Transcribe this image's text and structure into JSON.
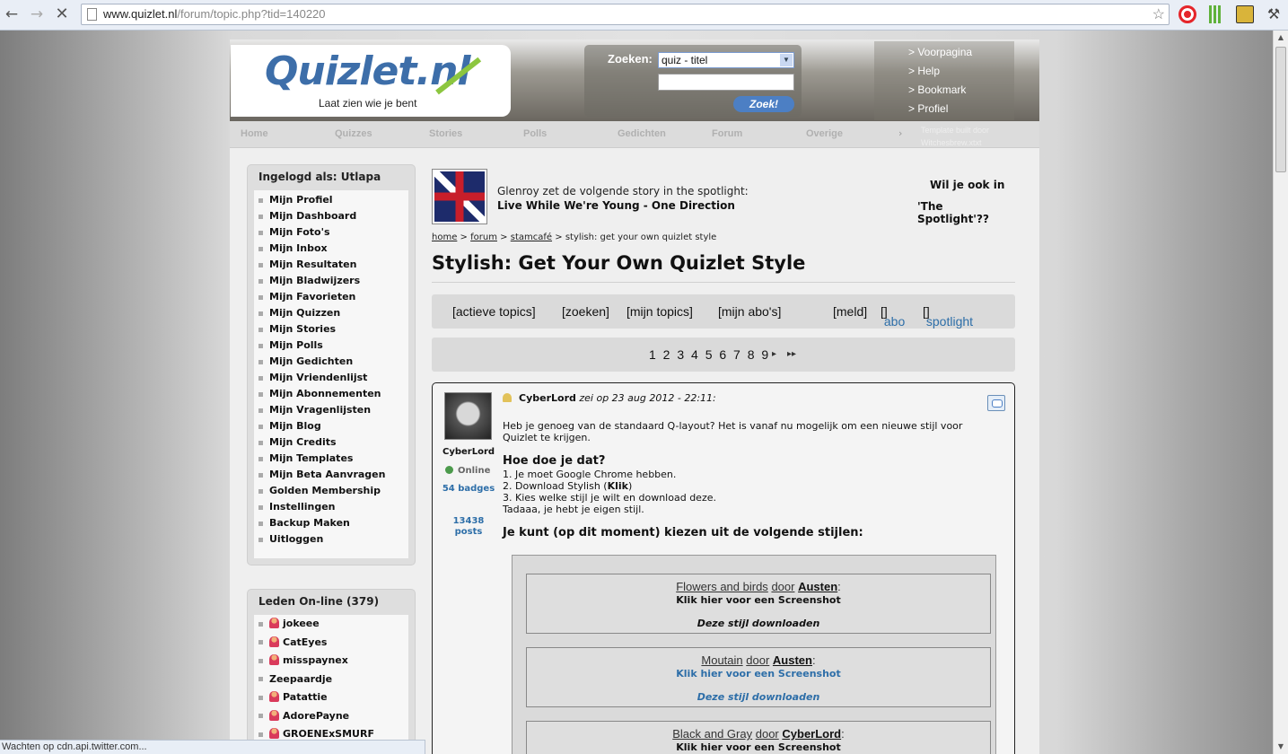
{
  "browser": {
    "url_host": "www.quizlet.nl",
    "url_path": "/forum/topic.php?tid=140220",
    "status": "Wachten op cdn.api.twitter.com..."
  },
  "header": {
    "logo": "Quizlet.nl",
    "tagline": "Laat zien wie je bent",
    "search_label": "Zoeken:",
    "search_select": "quiz - titel",
    "search_button": "Zoek!",
    "quicklinks": [
      "> Voorpagina",
      "> Help",
      "> Bookmark",
      "> Profiel"
    ]
  },
  "nav": {
    "items": [
      "Home",
      "Quizzes",
      "Stories",
      "Polls",
      "Gedichten",
      "Forum",
      "Overige"
    ],
    "template_line1": "Template built door",
    "template_line2": "Witchesbrew.xtxt"
  },
  "sidebar": {
    "login_title": "Ingelogd als: Utlapa",
    "menu": [
      "Mijn Profiel",
      "Mijn Dashboard",
      "Mijn Foto's",
      "Mijn Inbox",
      "Mijn Resultaten",
      "Mijn Bladwijzers",
      "Mijn Favorieten",
      "Mijn Quizzen",
      "Mijn Stories",
      "Mijn Polls",
      "Mijn Gedichten",
      "Mijn Vriendenlijst",
      "Mijn Abonnementen",
      "Mijn Vragenlijsten",
      "Mijn Blog",
      "Mijn Credits",
      "Mijn Templates",
      "Mijn Beta Aanvragen",
      "Golden Membership",
      "Instellingen",
      "Backup Maken",
      "Uitloggen"
    ],
    "online_title": "Leden On-line (379)",
    "online": [
      {
        "name": "jokeee",
        "icon": true
      },
      {
        "name": "CatEyes",
        "icon": true
      },
      {
        "name": "misspaynex",
        "icon": true
      },
      {
        "name": "Zeepaardje",
        "icon": false
      },
      {
        "name": "Patattie",
        "icon": true
      },
      {
        "name": "AdorePayne",
        "icon": true
      },
      {
        "name": "GROENExSMURF",
        "icon": true
      }
    ]
  },
  "spotlight": {
    "line1": "Glenroy zet de volgende story in the spotlight:",
    "line2": "Live While We're Young - One Direction",
    "ask1": "Wil je ook in",
    "ask2": "'The Spotlight'??"
  },
  "breadcrumb": {
    "home": "home",
    "sep": ">",
    "forum": "forum",
    "cafe": "stamcafé",
    "current": "stylish: get your own quizlet style"
  },
  "page_title": "Stylish: Get Your Own Quizlet Style",
  "topic_links": {
    "actieve": "[actieve topics]",
    "zoeken": "[zoeken]",
    "mijn_topics": "[mijn topics]",
    "mijn_abos": "[mijn abo's]",
    "meld": "[meld]",
    "abo": "abo",
    "spotlight": "spotlight"
  },
  "pager": {
    "pages": "1 2 3 4 5 6 7 8 9",
    "next": "▸",
    "last": "▸▸"
  },
  "post": {
    "author": "CyberLord",
    "status": "Online",
    "badges": "54 badges",
    "posts": "13438 posts",
    "said": "zei op 23 aug 2012 - 22:11:",
    "intro1": "Heb je genoeg van de standaard Q-layout? Het is vanaf nu mogelijk om een nieuwe stijl voor",
    "intro2": "Quizlet te krijgen.",
    "howto_title": "Hoe doe je dat?",
    "step1": "1. Je moet Google Chrome hebben.",
    "step2a": "2. Download Stylish (",
    "step2link": "Klik",
    "step2b": ")",
    "step3": "3. Kies welke stijl je wilt en download deze.",
    "tada": "Tadaaa, je hebt je eigen stijl.",
    "choose": "Je kunt (op dit moment) kiezen uit de volgende stijlen:",
    "styles": [
      {
        "name": "Flowers and birds",
        "by": "door",
        "author": "Austen",
        "screenshot": "Klik hier voor een Screenshot",
        "download": "Deze stijl downloaden"
      },
      {
        "name": "Moutain",
        "by": "door",
        "author": "Austen",
        "screenshot": "Klik hier voor een Screenshot",
        "download": "Deze stijl downloaden"
      },
      {
        "name": "Black and Gray",
        "by": "door",
        "author": "CyberLord",
        "screenshot": "Klik hier voor een Screenshot",
        "download": ""
      }
    ]
  }
}
